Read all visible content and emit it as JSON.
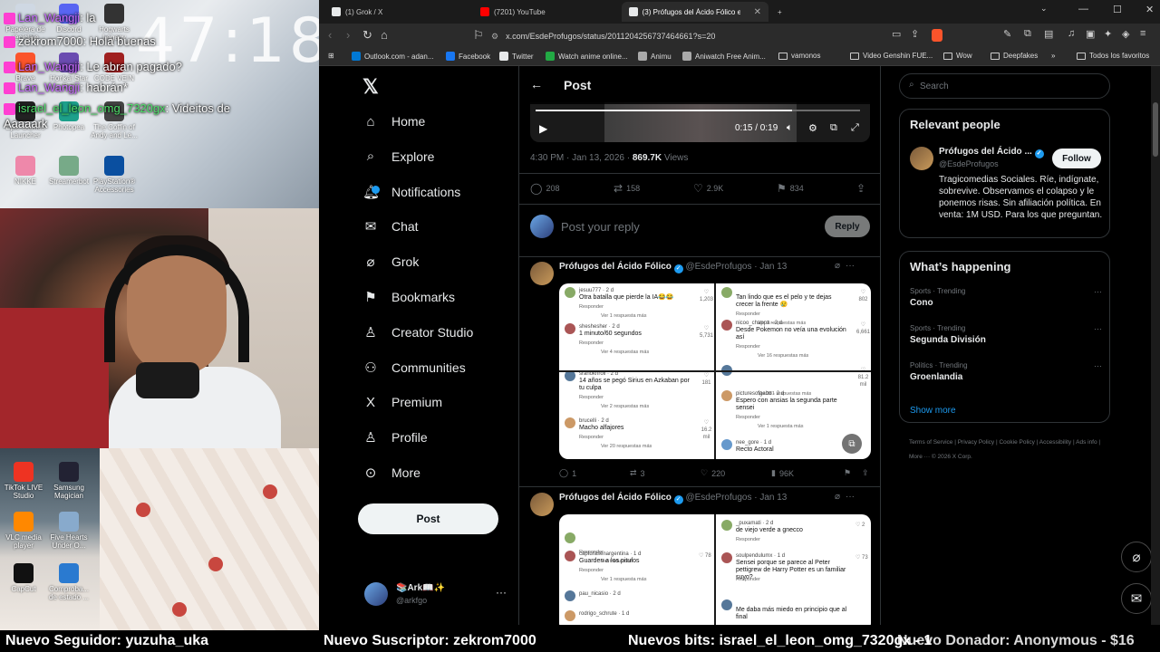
{
  "overlay": {
    "clock": "47:18",
    "desktop_icons_top": [
      {
        "label": "Papelera de reciclaje",
        "color": "#cfd8e3"
      },
      {
        "label": "Discord",
        "color": "#5865f2"
      },
      {
        "label": "Hogwarts Legacy",
        "color": "#333"
      },
      {
        "label": "Brave",
        "color": "#fb542b"
      },
      {
        "label": "Honkai Star Rail",
        "color": "#6a4bb0"
      },
      {
        "label": "CODE VEIN",
        "color": "#a02020"
      },
      {
        "label": "Epic Games Launcher",
        "color": "#222"
      },
      {
        "label": "Photopea",
        "color": "#1da08b"
      },
      {
        "label": "The Coffin of Andy and Le...",
        "color": "#444"
      },
      {
        "label": "NIKKE",
        "color": "#e8a"
      },
      {
        "label": "Streamerbot",
        "color": "#7a8"
      },
      {
        "label": "PlayStation® Accessories",
        "color": "#0a4fa0"
      }
    ],
    "desktop_icons_bottom": [
      {
        "label": "TikTok LIVE Studio",
        "color": "#e32"
      },
      {
        "label": "Samsung Magician",
        "color": "#223"
      },
      {
        "label": "VLC media player",
        "color": "#f80"
      },
      {
        "label": "Five Hearts Under O...",
        "color": "#8ac"
      },
      {
        "label": "CapCut",
        "color": "#111"
      },
      {
        "label": "Comproba... de estado ...",
        "color": "#2a7ad0"
      }
    ],
    "chat": [
      {
        "user": "Lan_Wangji",
        "sep": ":",
        "msg": "la",
        "color": "#c86bff"
      },
      {
        "user": "zekrom7000",
        "sep": ":",
        "msg": "Hola buenas",
        "color": "#ffffff"
      },
      {
        "user": "Lan_Wangji",
        "sep": ":",
        "msg": "Le abran pagado?",
        "color": "#c86bff"
      },
      {
        "user": "Lan_Wangji",
        "sep": ":",
        "msg": "habrán*",
        "color": "#c86bff"
      },
      {
        "user": "israel_el_leon_omg_7320gx",
        "sep": ":",
        "msg": "Videitos de",
        "color": "#4fe06b"
      },
      {
        "user": "",
        "sep": "",
        "msg": "Aaaaark",
        "color": "#ffffff"
      }
    ]
  },
  "browser": {
    "tabs": [
      {
        "label": "(1) Grok / X",
        "fav": "#e7e9ea"
      },
      {
        "label": "(7201) YouTube",
        "fav": "#ff0000"
      },
      {
        "label": "(3) Prófugos del Ácido Fólico en",
        "fav": "#e7e9ea"
      }
    ],
    "new_tab": "+",
    "url": "x.com/EsdeProfugos/status/2011204256737464661?s=20",
    "bookmarks": [
      {
        "label": "Outlook.com - adan...",
        "color": "#0078d4"
      },
      {
        "label": "Facebook",
        "color": "#1877f2"
      },
      {
        "label": "Twitter",
        "color": "#e7e9ea"
      },
      {
        "label": "Watch anime online...",
        "color": "#22aa44"
      },
      {
        "label": "Animu",
        "color": "#aaa"
      },
      {
        "label": "Aniwatch Free Anim...",
        "color": "#aaa"
      },
      {
        "label": "vamonos",
        "color": "folder"
      },
      {
        "label": "Video Genshin FUE...",
        "color": "folder"
      },
      {
        "label": "Wow",
        "color": "folder"
      },
      {
        "label": "Deepfakes",
        "color": "folder"
      }
    ],
    "bookmarks_overflow": "»",
    "bookmarks_all": "Todos los favoritos"
  },
  "xnav": {
    "items": [
      {
        "label": "Home",
        "icon": "home-icon",
        "glyph": "⌂"
      },
      {
        "label": "Explore",
        "icon": "search-icon",
        "glyph": "⌕"
      },
      {
        "label": "Notifications",
        "icon": "bell-icon",
        "glyph": "🔔︎"
      },
      {
        "label": "Chat",
        "icon": "mail-icon",
        "glyph": "✉"
      },
      {
        "label": "Grok",
        "icon": "grok-icon",
        "glyph": "⌀"
      },
      {
        "label": "Bookmarks",
        "icon": "bookmark-icon",
        "glyph": "⚑"
      },
      {
        "label": "Creator Studio",
        "icon": "creator-studio-icon",
        "glyph": "♙"
      },
      {
        "label": "Communities",
        "icon": "communities-icon",
        "glyph": "⚇"
      },
      {
        "label": "Premium",
        "icon": "x-premium-icon",
        "glyph": "X"
      },
      {
        "label": "Profile",
        "icon": "profile-icon",
        "glyph": "♙"
      },
      {
        "label": "More",
        "icon": "more-circle-icon",
        "glyph": "⊙"
      }
    ],
    "post_button": "Post",
    "account": {
      "name": "📚Ark📖✨",
      "handle": "@arkfgo"
    }
  },
  "center": {
    "title": "Post",
    "video_time": "0:15 / 0:19",
    "video_progress": 0.79,
    "meta_time": "4:30 PM · Jan 13, 2026 · ",
    "meta_views": "869.7K",
    "meta_views_label": " Views",
    "actions": {
      "replies": "208",
      "reposts": "158",
      "likes": "2.9K",
      "bookmarks": "834"
    },
    "reply_placeholder": "Post your reply",
    "reply_button": "Reply",
    "tweets": [
      {
        "name": "Prófugos del Ácido Fólico",
        "handle": "@EsdeProfugos",
        "date": "· Jan 13",
        "stats": {
          "replies": "1",
          "reposts": "3",
          "likes": "220",
          "views": "96K"
        },
        "comments_left": [
          {
            "user": "jesuu777 · 2 d",
            "text": "Otra batalla que pierde la IA😂😂",
            "reply": "Responder",
            "more": "Ver 1 respuesta más",
            "likes": "1,203"
          },
          {
            "user": "sheshesher · 2 d",
            "text": "1 minuto/60 segundos",
            "reply": "Responder",
            "more": "Ver 4 respuestas más",
            "likes": "5,731"
          },
          {
            "user": "sranoknroll · 2 d",
            "text": "14 años se pegó Sirius en Azkaban por tu culpa",
            "reply": "Responder",
            "more": "Ver 2 respuestas más",
            "likes": "181"
          },
          {
            "user": "brucelli · 2 d",
            "text": "Macho alfajores",
            "reply": "Responder",
            "more": "Ver 20 respuestas más",
            "likes": "16.2 mil"
          }
        ],
        "comments_right": [
          {
            "user": "",
            "text": "Tan lindo que es el pelo y te dejas crecer la frente 😢",
            "reply": "Responder",
            "more": "Ver 7 respuestas más",
            "likes": "802"
          },
          {
            "user": "nicoo_chappa · 2 d",
            "text": "Desde Pokemon no veía una evolución así",
            "reply": "Responder",
            "more": "Ver 16 respuestas más",
            "likes": "6,661"
          },
          {
            "user": "",
            "text": "",
            "reply": "",
            "more": "Ver 281 respuestas más",
            "likes": "81.2 mil"
          },
          {
            "user": "picturesofgabo · 2 d",
            "text": "Espero con ansias la segunda parte sensei",
            "reply": "Responder",
            "more": "Ver 1 respuesta más",
            "likes": ""
          },
          {
            "user": "nee_gore · 1 d",
            "text": "Recto Actoral",
            "reply": "",
            "more": "",
            "likes": ""
          }
        ]
      },
      {
        "name": "Prófugos del Ácido Fólico",
        "handle": "@EsdeProfugos",
        "date": "· Jan 13",
        "comments_left": [
          {
            "user": "",
            "text": "",
            "reply": "Responder",
            "more": "Ver traducción",
            "likes": ""
          },
          {
            "user": "capturasenargentina · 1 d",
            "text": "Guarden a los pitufos",
            "reply": "Responder",
            "more": "Ver 1 respuesta más",
            "likes": "78"
          },
          {
            "user": "pau_nicasio · 2 d",
            "text": "",
            "reply": "",
            "more": "",
            "likes": ""
          },
          {
            "user": "rodrigo_schrute · 1 d",
            "text": "",
            "reply": "",
            "more": "",
            "likes": ""
          }
        ],
        "comments_right": [
          {
            "user": "_puxamati · 2 d",
            "text": "de viejo verde a gnecco",
            "reply": "Responder",
            "more": "",
            "likes": "2"
          },
          {
            "user": "soulpendulumx · 1 d",
            "text": "Sensei porque se parece al Peter pettigrew de Harry Potter es un familiar suyo?",
            "reply": "Responder",
            "more": "",
            "likes": "73"
          },
          {
            "user": "",
            "text": "Me daba más miedo en principio que al final",
            "reply": "",
            "more": "",
            "likes": ""
          }
        ]
      }
    ]
  },
  "right": {
    "search_placeholder": "Search",
    "relevant_title": "Relevant people",
    "person": {
      "name": "Prófugos del Ácido ...",
      "handle": "@EsdeProfugos",
      "follow": "Follow",
      "bio": "Tragicomedias Sociales. Ríe, indígnate, sobrevive. Observamos el colapso y le ponemos risas. Sin afiliación política. En venta: 1M USD. Para los que preguntan."
    },
    "happening_title": "What’s happening",
    "trends": [
      {
        "category": "Sports · Trending",
        "name": "Cono"
      },
      {
        "category": "Sports · Trending",
        "name": "Segunda División"
      },
      {
        "category": "Politics · Trending",
        "name": "Groenlandia"
      }
    ],
    "show_more": "Show more",
    "footer": "Terms of Service  |  Privacy Policy  |  Cookie Policy  |  Accessibility  |  Ads info  |  More ···  © 2026 X Corp."
  },
  "ticker": [
    "Nuevo Seguidor: yuzuha_uka",
    "Nuevo Suscriptor: zekrom7000",
    "Nuevos bits: israel_el_leon_omg_7320gx - 1",
    "Nuevo Donador: Anonymous - $16"
  ]
}
